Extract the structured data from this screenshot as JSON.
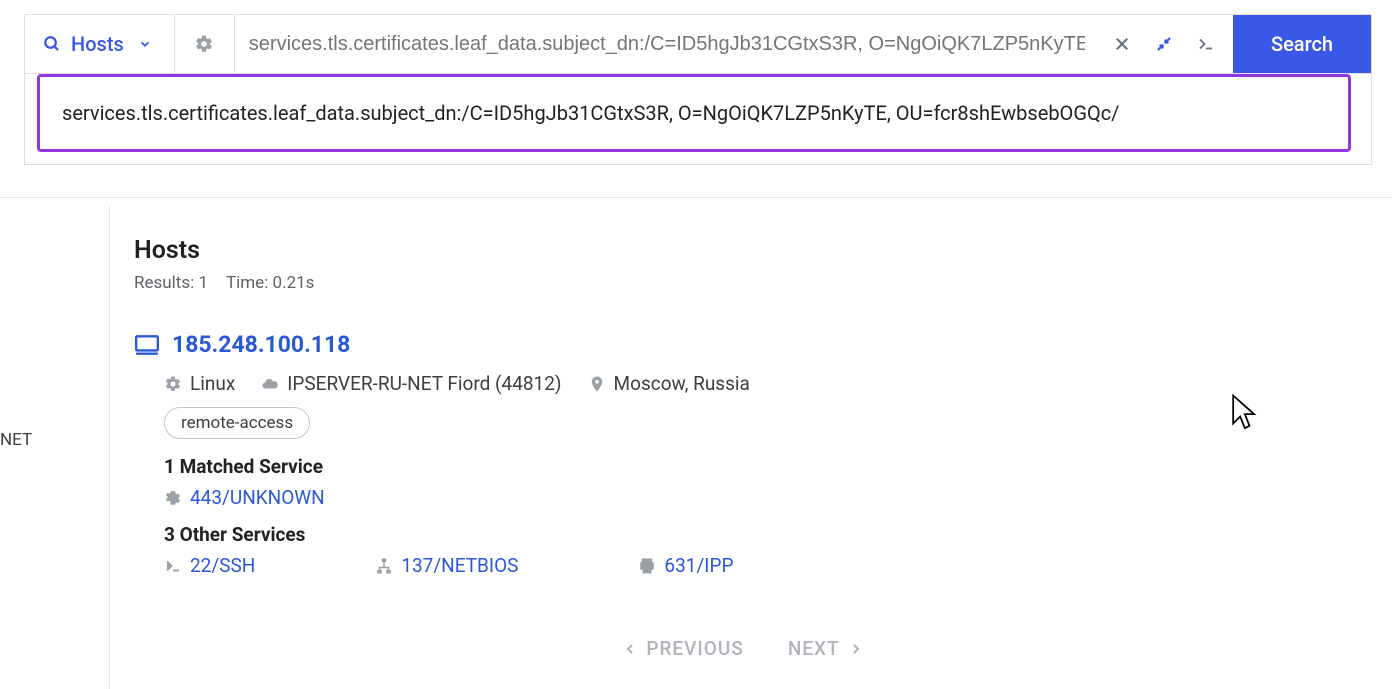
{
  "header": {
    "hosts_label": "Hosts",
    "search_placeholder": "services.tls.certificates.leaf_data.subject_dn:/C=ID5hgJb31CGtxS3R, O=NgOiQK7LZP5nKyTE, OU=fcr8shEwbsebOGQc/",
    "search_button": "Search",
    "expanded_query": "services.tls.certificates.leaf_data.subject_dn:/C=ID5hgJb31CGtxS3R, O=NgOiQK7LZP5nKyTE, OU=fcr8shEwbsebOGQc/"
  },
  "sidebar": {
    "fragment": "NET"
  },
  "results": {
    "title": "Hosts",
    "results_label": "Results: 1",
    "time_label": "Time: 0.21s"
  },
  "host": {
    "ip": "185.248.100.118",
    "os": "Linux",
    "asn": "IPSERVER-RU-NET Fiord (44812)",
    "location": "Moscow, Russia",
    "tag": "remote-access",
    "matched_heading": "1 Matched Service",
    "matched_service": "443/UNKNOWN",
    "other_heading": "3 Other Services",
    "other_services": {
      "ssh": "22/SSH",
      "netbios": "137/NETBIOS",
      "ipp": "631/IPP"
    }
  },
  "pager": {
    "prev": "PREVIOUS",
    "next": "NEXT"
  }
}
